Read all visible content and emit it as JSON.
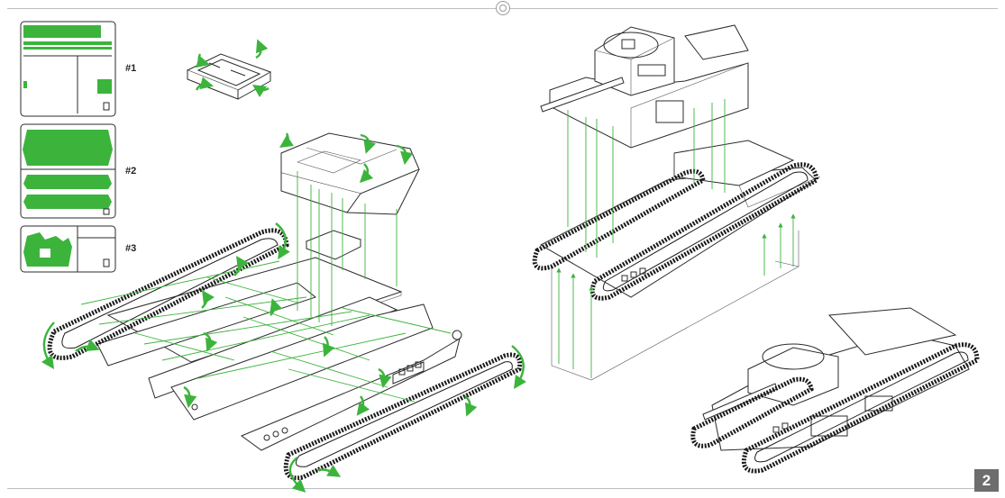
{
  "page": {
    "number": "2",
    "accent_color": "#3cb43c",
    "line_color": "#2b2b2b"
  },
  "sheets": [
    {
      "label": "#1"
    },
    {
      "label": "#2"
    },
    {
      "label": "#3"
    }
  ]
}
